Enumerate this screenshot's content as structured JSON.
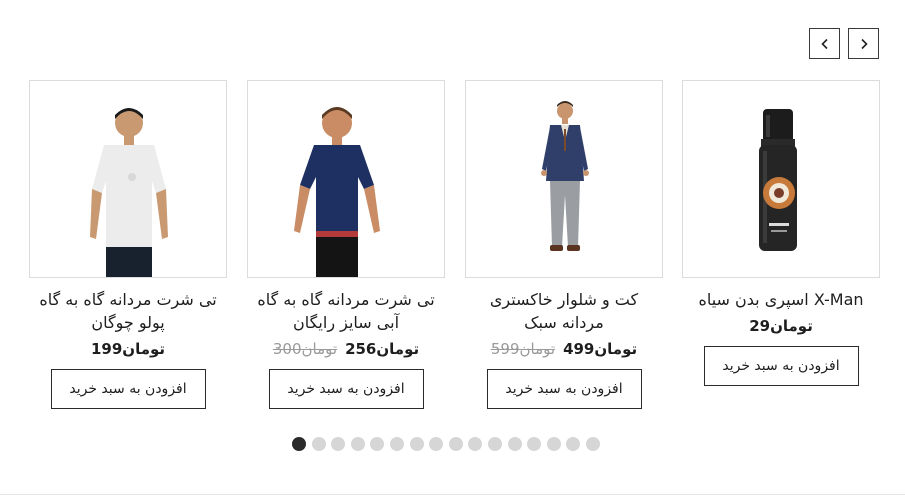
{
  "products": [
    {
      "title": "X-Man اسپری بدن سیاه",
      "price": "29",
      "old_price": "",
      "currency": "تومان",
      "cart_label": "افزودن به سبد خرید",
      "image": "spray-bottle-image"
    },
    {
      "title": "کت و شلوار خاکستری مردانه سبک",
      "price": "499",
      "old_price": "599",
      "currency": "تومان",
      "cart_label": "افزودن به سبد خرید",
      "image": "suit-model-image"
    },
    {
      "title": "تی شرت مردانه گاه به گاه آبی سایز رایگان",
      "price": "256",
      "old_price": "300",
      "currency": "تومان",
      "cart_label": "افزودن به سبد خرید",
      "image": "blue-tshirt-model-image"
    },
    {
      "title": "تی شرت مردانه گاه به گاه پولو چوگان",
      "price": "199",
      "old_price": "",
      "currency": "تومان",
      "cart_label": "افزودن به سبد خرید",
      "image": "white-tshirt-model-image"
    }
  ],
  "carousel": {
    "dot_count": 16,
    "active_dot": 1
  },
  "icons": {
    "prev": "chevron-left-icon",
    "next": "chevron-right-icon"
  },
  "colors": {
    "border": "#dcdcdc",
    "button_border": "#2b2b2b",
    "dot_inactive": "#d6d6d6",
    "dot_active": "#2a2a2a",
    "old_price": "#9a9a9a"
  }
}
